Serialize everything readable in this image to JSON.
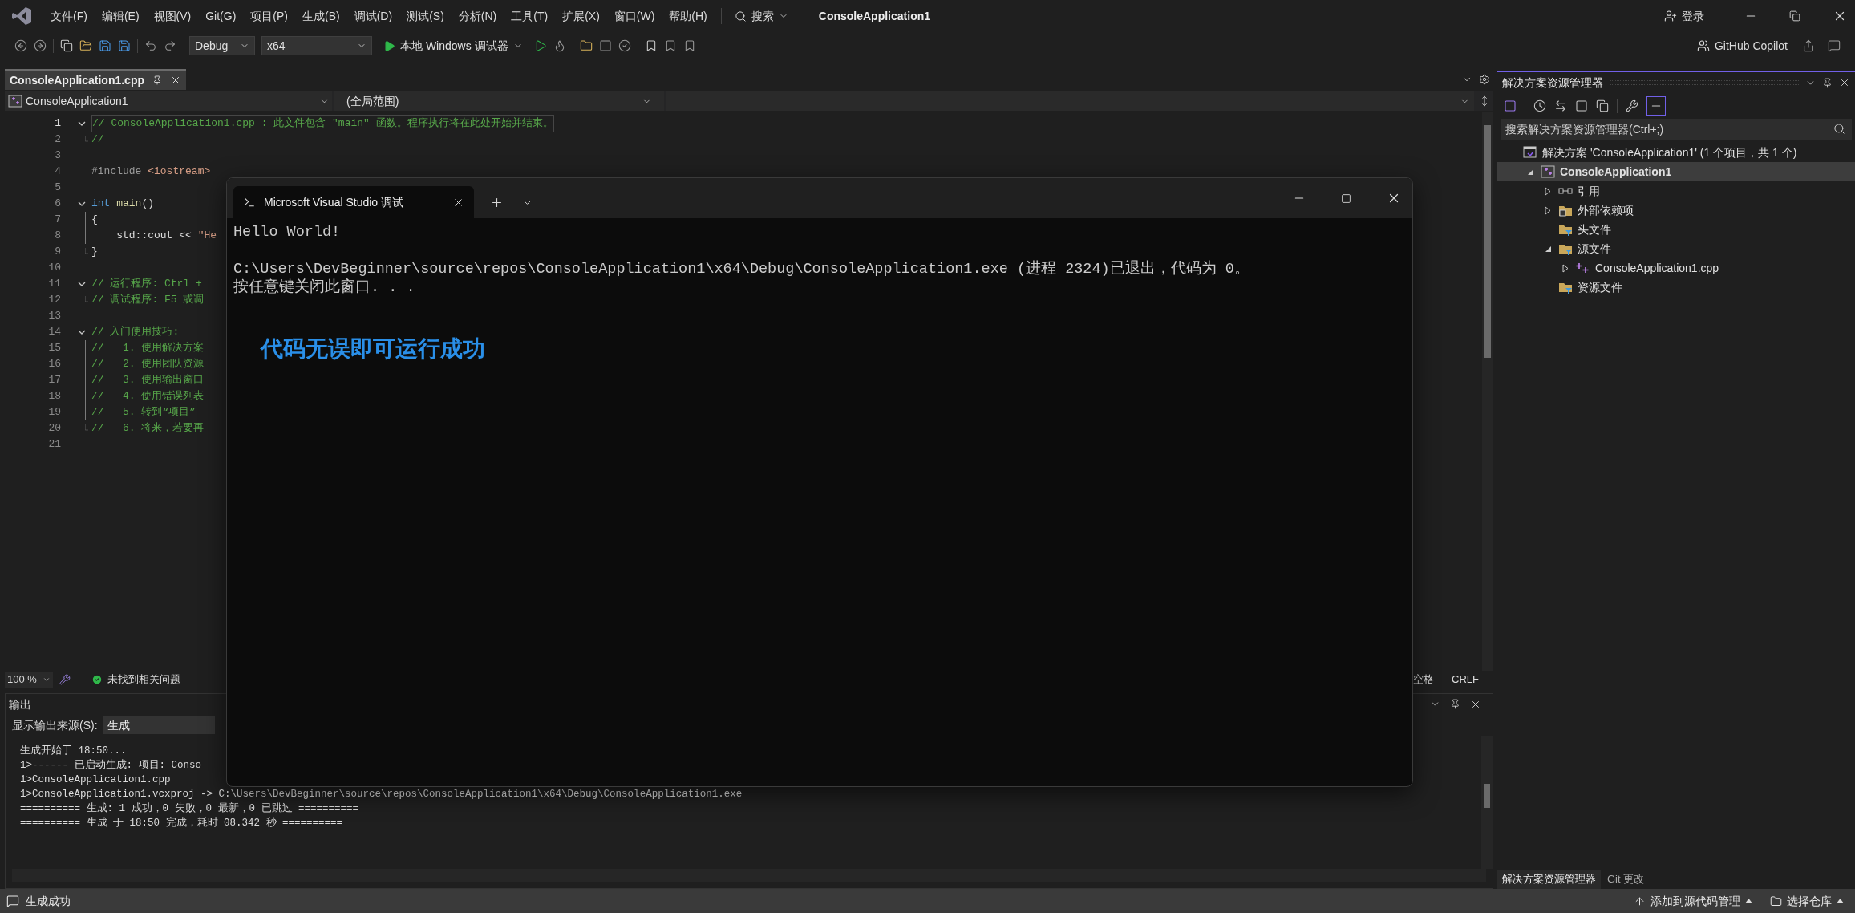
{
  "window": {
    "title": "ConsoleApplication1",
    "sign_in": "登录",
    "copilot": "GitHub Copilot"
  },
  "menu": [
    "文件(F)",
    "编辑(E)",
    "视图(V)",
    "Git(G)",
    "项目(P)",
    "生成(B)",
    "调试(D)",
    "测试(S)",
    "分析(N)",
    "工具(T)",
    "扩展(X)",
    "窗口(W)",
    "帮助(H)"
  ],
  "search": {
    "label": "搜索"
  },
  "toolbar": {
    "configuration": "Debug",
    "platform": "x64",
    "run": "本地 Windows 调试器"
  },
  "editor": {
    "tabs": [
      {
        "label": "ConsoleApplication1.cpp",
        "selected": true
      }
    ],
    "project_scope": "ConsoleApplication1",
    "function_scope": "(全局范围)",
    "lines": [
      {
        "number": "1",
        "kind": "opener",
        "tokens": [
          {
            "text": "// ConsoleApplication1.cpp : 此文件包含 \"main\" 函数。程序执行将在此处开始并结束。",
            "kind": "comment"
          }
        ]
      },
      {
        "number": "2",
        "kind": "closer",
        "tokens": [
          {
            "text": "//",
            "kind": "comment"
          }
        ]
      },
      {
        "number": "3",
        "kind": "plain"
      },
      {
        "number": "4",
        "kind": "plain",
        "tokens": [
          {
            "text": "#include ",
            "kind": "preprocessor"
          },
          {
            "text": "<iostream>",
            "kind": "string"
          }
        ]
      },
      {
        "number": "5",
        "kind": "plain"
      },
      {
        "number": "6",
        "kind": "opener",
        "tokens": [
          {
            "text": "int",
            "kind": "keyword"
          },
          {
            "text": " main",
            "kind": "function"
          },
          {
            "text": "()",
            "kind": "plain"
          }
        ]
      },
      {
        "number": "7",
        "kind": "inner",
        "tokens": [
          {
            "text": "{",
            "kind": "plain"
          }
        ]
      },
      {
        "number": "8",
        "kind": "inner",
        "tokens": [
          {
            "text": "    std::cout << ",
            "kind": "plain"
          },
          {
            "text": "\"He",
            "kind": "string"
          }
        ]
      },
      {
        "number": "9",
        "kind": "closer",
        "tokens": [
          {
            "text": "}",
            "kind": "plain"
          }
        ]
      },
      {
        "number": "10",
        "kind": "plain"
      },
      {
        "number": "11",
        "kind": "opener",
        "tokens": [
          {
            "text": "// 运行程序: Ctrl +",
            "kind": "comment"
          }
        ]
      },
      {
        "number": "12",
        "kind": "closer",
        "tokens": [
          {
            "text": "// 调试程序: F5 或调",
            "kind": "comment"
          }
        ]
      },
      {
        "number": "13",
        "kind": "plain"
      },
      {
        "number": "14",
        "kind": "opener",
        "tokens": [
          {
            "text": "// 入门使用技巧:",
            "kind": "comment"
          }
        ]
      },
      {
        "number": "15",
        "kind": "inner",
        "tokens": [
          {
            "text": "//   1. 使用解决方案",
            "kind": "comment"
          }
        ]
      },
      {
        "number": "16",
        "kind": "inner",
        "tokens": [
          {
            "text": "//   2. 使用团队资源",
            "kind": "comment"
          }
        ]
      },
      {
        "number": "17",
        "kind": "inner",
        "tokens": [
          {
            "text": "//   3. 使用输出窗口",
            "kind": "comment"
          }
        ]
      },
      {
        "number": "18",
        "kind": "inner",
        "tokens": [
          {
            "text": "//   4. 使用错误列表",
            "kind": "comment"
          }
        ]
      },
      {
        "number": "19",
        "kind": "inner",
        "tokens": [
          {
            "text": "//   5. 转到“项目”",
            "kind": "comment"
          }
        ]
      },
      {
        "number": "20",
        "kind": "closer",
        "tokens": [
          {
            "text": "//   6. 将来，若要再",
            "kind": "comment"
          }
        ]
      },
      {
        "number": "21",
        "kind": "plain"
      }
    ]
  },
  "editor_status": {
    "zoom": "100 %",
    "issues": "未找到相关问题",
    "indent": "空格",
    "line_ending": "CRLF"
  },
  "output": {
    "title": "输出",
    "source_label": "显示输出来源(S):",
    "source": "生成",
    "lines": [
      "生成开始于 18:50...",
      "1>------ 已启动生成: 项目: Conso",
      "1>ConsoleApplication1.cpp",
      "1>ConsoleApplication1.vcxproj -> C:\\Users\\DevBeginner\\source\\repos\\ConsoleApplication1\\x64\\Debug\\ConsoleApplication1.exe",
      "========== 生成: 1 成功，0 失败，0 最新，0 已跳过 ==========",
      "========== 生成 于 18:50 完成，耗时 08.342 秒 =========="
    ]
  },
  "solution_explorer": {
    "title": "解决方案资源管理器",
    "search": {
      "placeholder": "搜索解决方案资源管理器(Ctrl+;)"
    },
    "tree": [
      {
        "label": "解决方案 'ConsoleApplication1' (1 个项目，共 1 个)",
        "kind": "solution",
        "selected": false,
        "children": [
          {
            "label": "ConsoleApplication1",
            "kind": "project",
            "selected": true,
            "expanded": true,
            "children": [
              {
                "label": "引用",
                "kind": "references",
                "selected": false,
                "expanded": false
              },
              {
                "label": "外部依赖项",
                "kind": "external",
                "selected": false,
                "expanded": false
              },
              {
                "label": "头文件",
                "kind": "filter",
                "selected": false
              },
              {
                "label": "源文件",
                "kind": "filter",
                "selected": false,
                "expanded": true,
                "children": [
                  {
                    "label": "ConsoleApplication1.cpp",
                    "kind": "cpp",
                    "selected": false,
                    "expanded": false
                  }
                ]
              },
              {
                "label": "资源文件",
                "kind": "filter",
                "selected": false
              }
            ]
          }
        ]
      }
    ],
    "tabs": [
      {
        "label": "解决方案资源管理器",
        "selected": true
      },
      {
        "label": "Git 更改",
        "selected": false
      }
    ]
  },
  "console": {
    "tab_title": "Microsoft Visual Studio 调试",
    "blocks": [
      [
        "Hello World!"
      ],
      [
        "C:\\Users\\DevBeginner\\source\\repos\\ConsoleApplication1\\x64\\Debug\\ConsoleApplication1.exe (进程 2324)已退出，代码为 0。",
        "按任意键关闭此窗口. . ."
      ]
    ]
  },
  "annotation": "代码无误即可运行成功",
  "status_bar": {
    "message": "生成成功",
    "source_control": "添加到源代码管理",
    "repository": "选择仓库"
  }
}
